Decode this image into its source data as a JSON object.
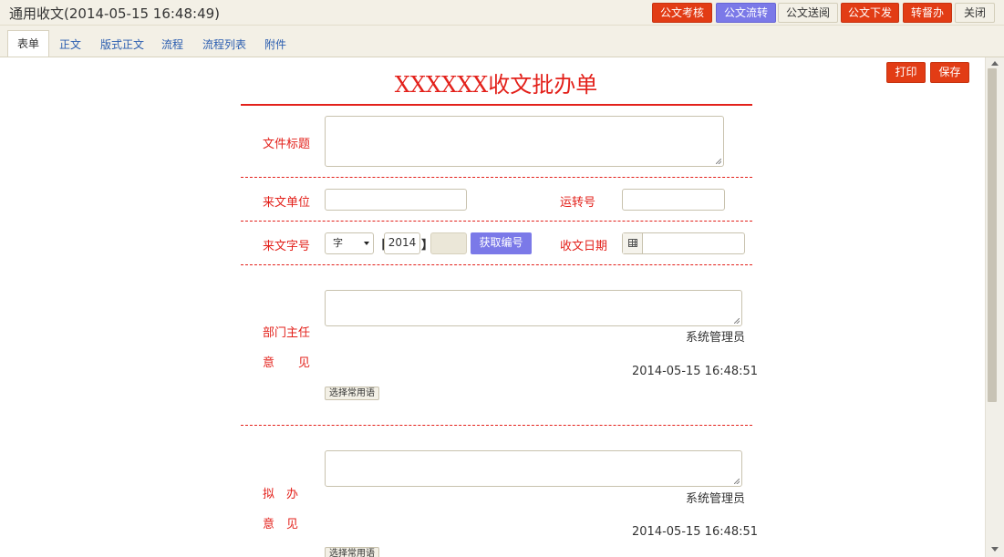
{
  "window": {
    "title": "通用收文(2014-05-15 16:48:49)"
  },
  "toolbar": {
    "review": "公文考核",
    "circulate": "公文流转",
    "send_read": "公文送阅",
    "issue": "公文下发",
    "supervise": "转督办",
    "close": "关闭"
  },
  "tabs": [
    "表单",
    "正文",
    "版式正文",
    "流程",
    "流程列表",
    "附件"
  ],
  "actions": {
    "print": "打印",
    "save": "保存"
  },
  "form": {
    "title": "XXXXXX收文批办单",
    "fields": {
      "doc_title_label": "文件标题",
      "doc_title_value": "",
      "source_unit_label": "来文单位",
      "source_unit_value": "",
      "transfer_no_label": "运转号",
      "transfer_no_value": "",
      "doc_ref_label": "来文字号",
      "doc_ref_prefix": "字",
      "bracket_open": "【",
      "doc_ref_year": "2014",
      "bracket_close": "】",
      "doc_ref_number": "",
      "fetch_number": "获取编号",
      "receive_date_label": "收文日期",
      "receive_date_value": ""
    },
    "opinions": [
      {
        "label_line1": "部门主任",
        "label_line2": "意　　见",
        "value": "",
        "user": "系统管理员",
        "time": "2014-05-15 16:48:51",
        "phrase_button": "选择常用语"
      },
      {
        "label_line1": "拟　办",
        "label_line2": "意　见",
        "value": "",
        "user": "系统管理员",
        "time": "2014-05-15 16:48:51",
        "phrase_button": "选择常用语"
      }
    ]
  },
  "colors": {
    "accent_red": "#e3211b",
    "button_red": "#e23c15",
    "button_purple": "#7b79e8"
  }
}
